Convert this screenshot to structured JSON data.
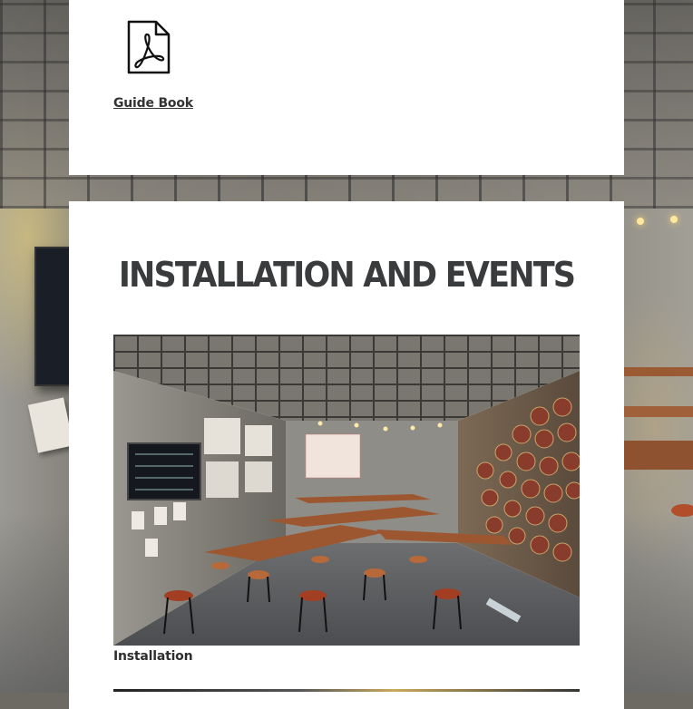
{
  "downloads": {
    "guide_book": {
      "label": "Guide Book",
      "icon": "pdf-icon"
    }
  },
  "section": {
    "title": "INSTALLATION AND EVENTS"
  },
  "gallery": [
    {
      "caption": "Installation",
      "image": "installation-photo"
    }
  ],
  "colors": {
    "card_background": "#ffffff",
    "title_text": "#3a3b3d",
    "body_text": "#333333"
  }
}
